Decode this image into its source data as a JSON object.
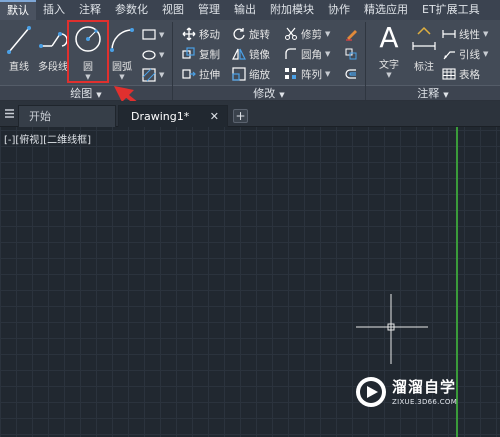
{
  "ribbon_tabs": [
    "默认",
    "插入",
    "注释",
    "参数化",
    "视图",
    "管理",
    "输出",
    "附加模块",
    "协作",
    "精选应用",
    "ET扩展工具"
  ],
  "draw_panel": {
    "line": "直线",
    "polyline": "多段线",
    "circle": "圆",
    "arc": "圆弧",
    "title": "绘图"
  },
  "modify_panel": {
    "move": "移动",
    "rotate": "旋转",
    "trim": "修剪",
    "copy": "复制",
    "mirror": "镜像",
    "fillet": "圆角",
    "stretch": "拉伸",
    "scale": "缩放",
    "array": "阵列",
    "title": "修改"
  },
  "annotation_panel": {
    "text": "文字",
    "dimension": "标注",
    "linear": "线性",
    "leader": "引线",
    "table": "表格",
    "title": "注释"
  },
  "doc_tabs": {
    "start": "开始",
    "drawing": "Drawing1*",
    "close": "✕",
    "add": "+"
  },
  "viewport_label": "[-][俯视][二维线框]",
  "watermark": {
    "title": "溜溜自学",
    "url": "ZIXUE.3D66.COM"
  },
  "colors": {
    "accent_highlight": "#e0302e",
    "axis_green": "#3a9b3a",
    "canvas_bg": "#212830"
  }
}
